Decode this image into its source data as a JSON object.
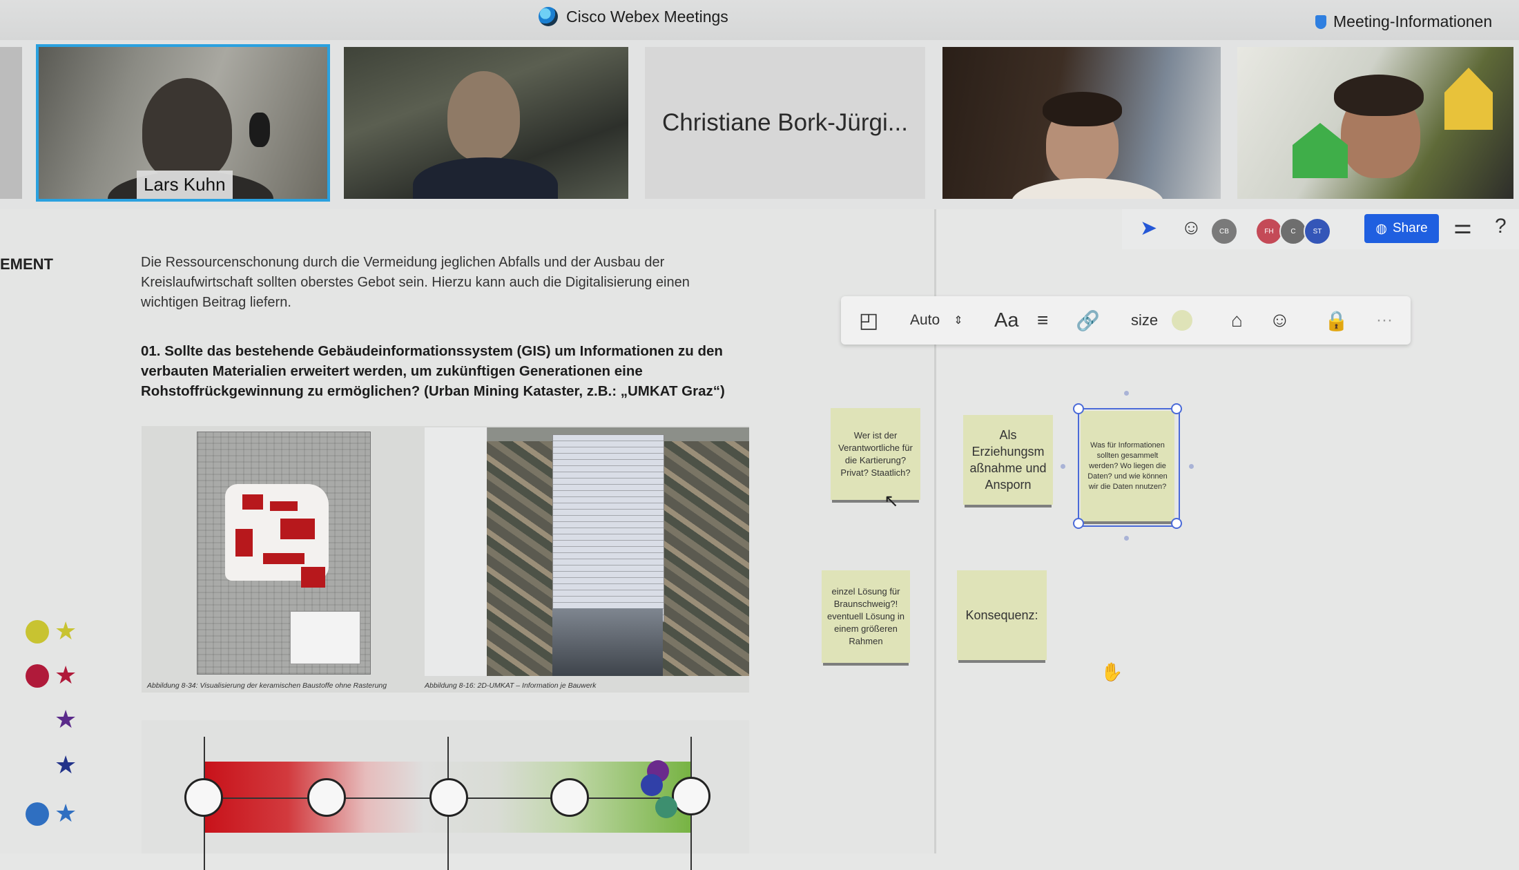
{
  "window": {
    "app_title": "Cisco Webex Meetings",
    "meeting_info_label": "Meeting-Informationen"
  },
  "participants": [
    {
      "name": "Lars Kuhn",
      "video": true,
      "active_speaker": true
    },
    {
      "name": "",
      "video": true
    },
    {
      "name": "Christiane Bork-Jürgi...",
      "video": false
    },
    {
      "name": "",
      "video": true
    },
    {
      "name": "",
      "video": true
    }
  ],
  "document": {
    "section_heading": "EMENT",
    "intro": "Die Ressourcenschonung durch die Vermeidung jeglichen Abfalls und der Ausbau der Kreislaufwirtschaft sollten oberstes Gebot sein. Hierzu kann auch die Digitalisierung einen wichtigen Beitrag liefern.",
    "question": "01. Sollte das bestehende Gebäudeinformationssystem (GIS) um Informationen zu den verbauten Materialien erweitert werden, um zukünftigen Generationen eine Rohstoffrückgewinnung zu ermöglichen? (Urban Mining Kataster, z.B.: „UMKAT Graz“)",
    "caption_left": "Abbildung 8-34: Visualisierung der keramischen Baustoffe ohne Rasterung",
    "caption_right": "Abbildung 8-16: 2D-UMKAT – Information je Bauwerk"
  },
  "legend": {
    "colors": {
      "yellow": "#c8c331",
      "red": "#b01a3a",
      "purple": "#5a2a8a",
      "navy": "#22338a",
      "blue": "#2f6fc1"
    }
  },
  "rating_scale": {
    "points": 5,
    "votes_at_right_end": 3
  },
  "whiteboard": {
    "share_label": "Share",
    "collaborators": [
      "CB",
      "FH",
      "C",
      "ST"
    ],
    "toolbar": {
      "font_mode": "Auto",
      "text_icon": "Aa",
      "size_label": "size",
      "more": "···"
    },
    "sticky_notes": [
      "Wer ist der Verantwortliche für die Kartierung? Privat? Staatlich?",
      "Als Erziehungsm aßnahme und Ansporn",
      "Was für Informationen sollten gesammelt werden? Wo liegen die Daten? und wie können wir die Daten nnutzen?",
      "einzel Lösung für Braunschweig?! eventuell Lösung in einem größeren Rahmen",
      "Konsequenz:"
    ],
    "colors": {
      "sticky": "#dfe3b8",
      "share_button": "#1f5fe0",
      "selection": "#4a6ad8"
    }
  }
}
